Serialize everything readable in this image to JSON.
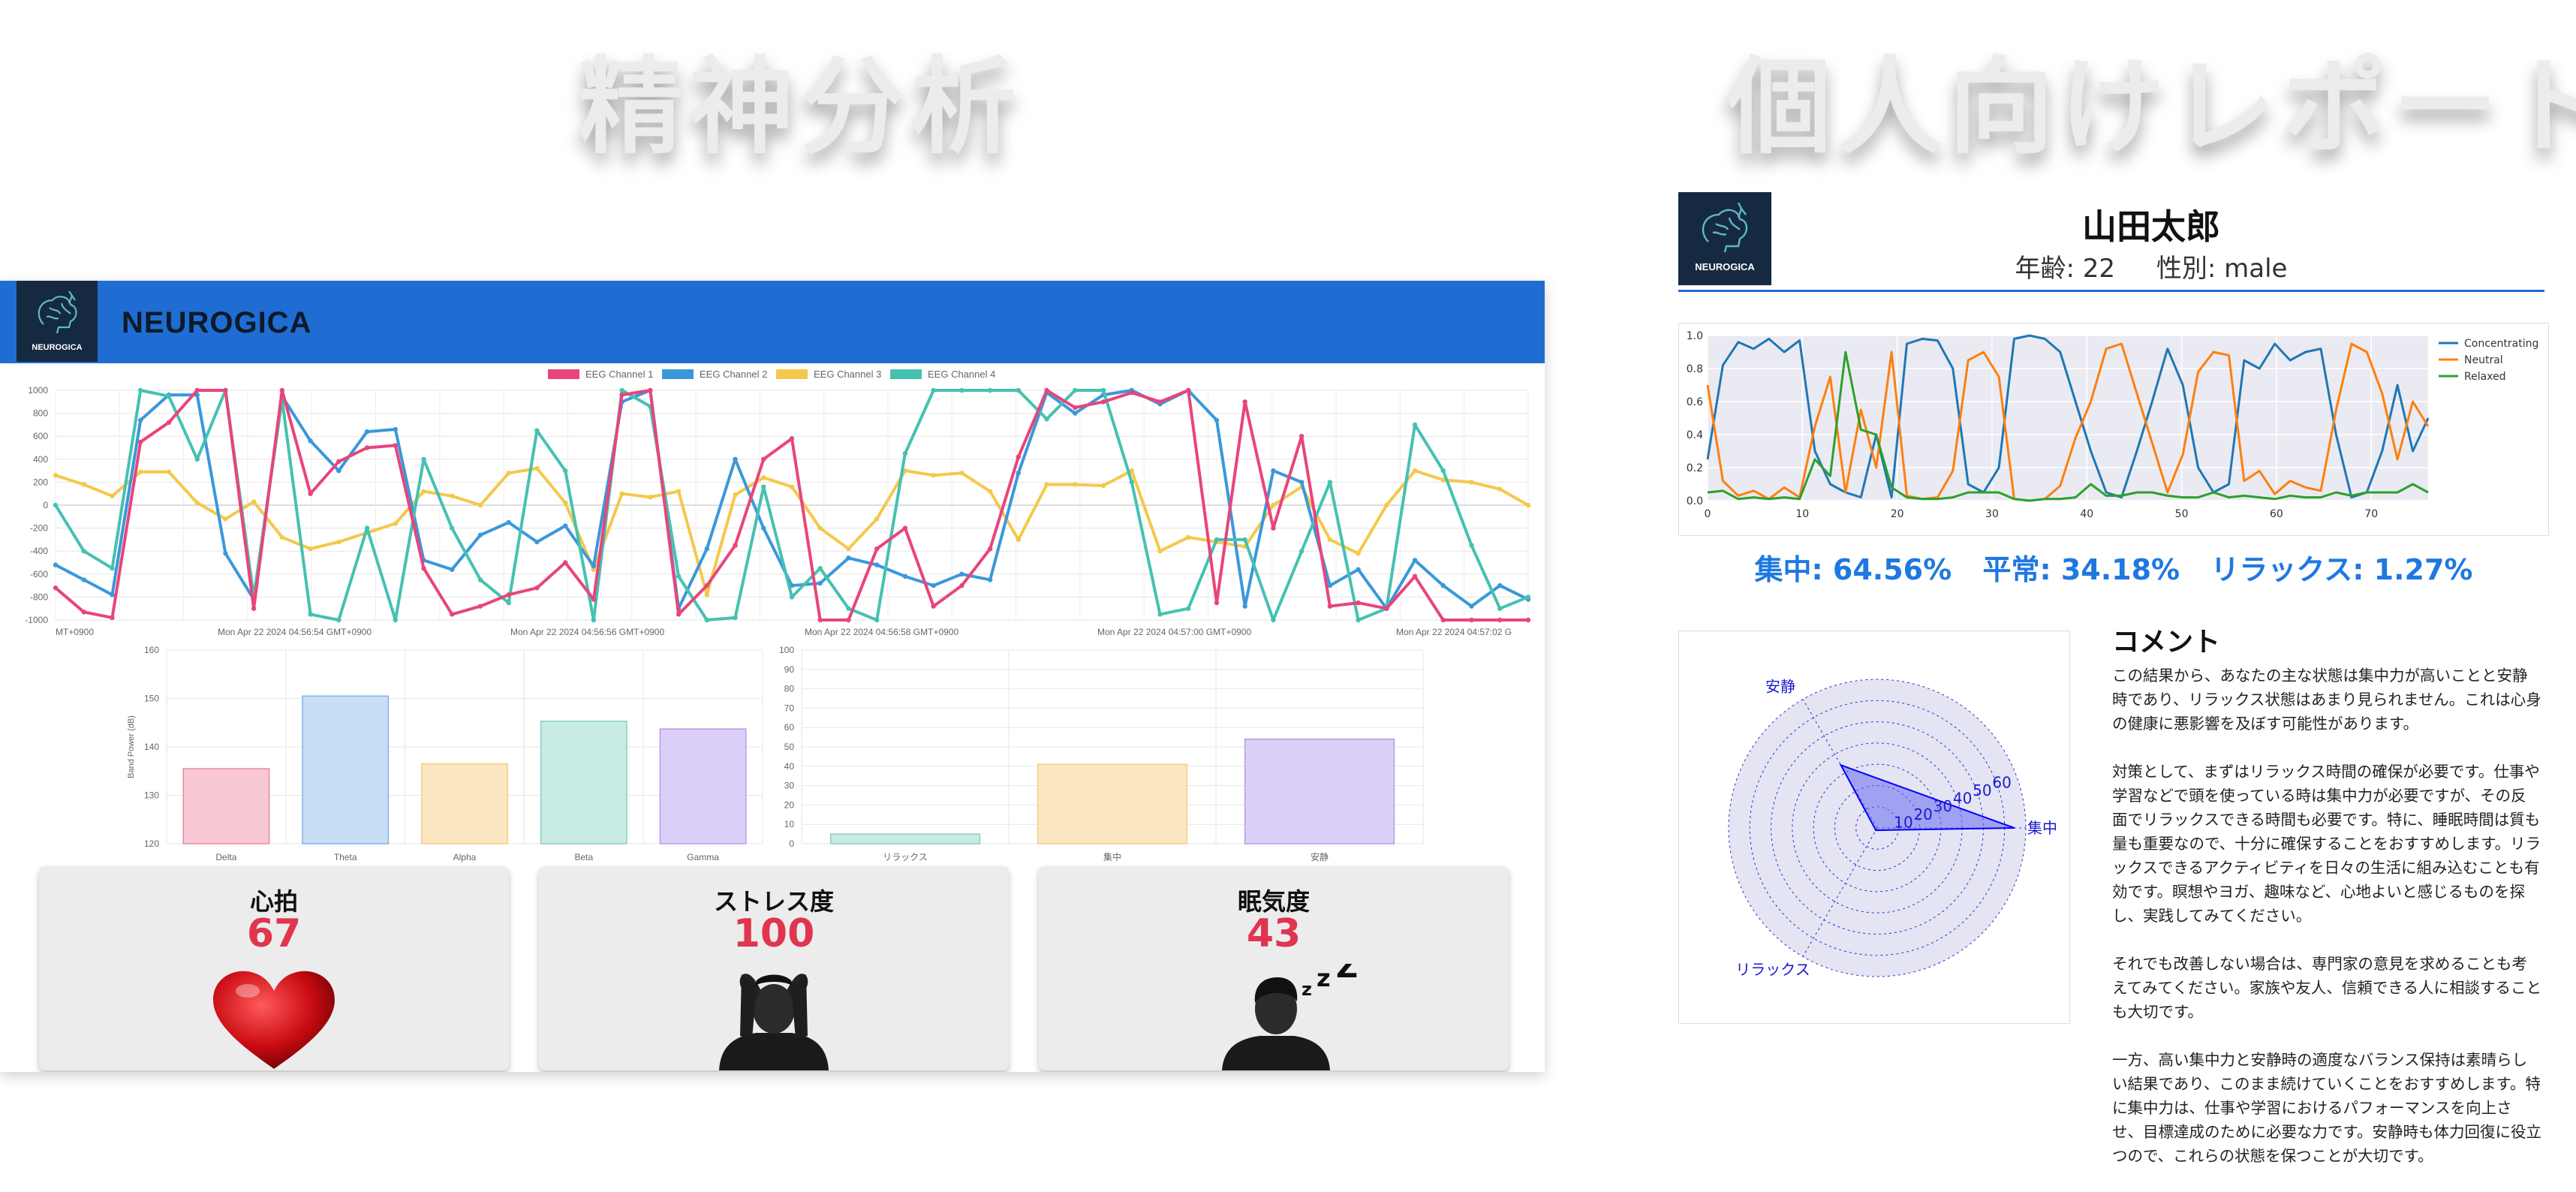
{
  "headlines": {
    "left": "精神分析",
    "right": "個人向けレポート"
  },
  "dashboard": {
    "brand": "NEUROGICA",
    "logo_text": "NEUROGICA",
    "metrics": [
      {
        "label": "心拍",
        "value": "67",
        "icon": "heart-icon"
      },
      {
        "label": "ストレス度",
        "value": "100",
        "icon": "stressed-person-icon"
      },
      {
        "label": "眠気度",
        "value": "43",
        "icon": "sleepy-person-icon"
      }
    ]
  },
  "colors": {
    "brand_blue": "#1f6dd2",
    "metric_red": "#e0344f",
    "summary_blue": "#1f78e0"
  },
  "chart_data": [
    {
      "type": "line",
      "legend": [
        "EEG Channel 1",
        "EEG Channel 2",
        "EEG Channel 3",
        "EEG Channel 4"
      ],
      "legend_position": "top",
      "colors": [
        "#e8457a",
        "#3a98da",
        "#f4c84b",
        "#45c1b2"
      ],
      "ylim": [
        -1000,
        1000
      ],
      "yticks": [
        "1000",
        "800",
        "600",
        "400",
        "200",
        "0",
        "-200",
        "-400",
        "-600",
        "-800",
        "-1000"
      ],
      "xtick_labels": [
        "MT+0900",
        "Mon Apr 22 2024 04:56:54 GMT+0900",
        "Mon Apr 22 2024 04:56:56 GMT+0900",
        "Mon Apr 22 2024 04:56:58 GMT+0900",
        "Mon Apr 22 2024 04:57:00 GMT+0900",
        "Mon Apr 22 2024 04:57:02 G"
      ],
      "series": [
        {
          "name": "EEG Channel 1",
          "values": [
            -720,
            -930,
            -980,
            550,
            720,
            1000,
            1000,
            -900,
            1000,
            100,
            380,
            500,
            520,
            -550,
            -950,
            -880,
            -780,
            -720,
            -500,
            -820,
            960,
            1000,
            -950,
            -700,
            -350,
            400,
            580,
            -1000,
            -1000,
            -380,
            -200,
            -880,
            -700,
            -380,
            420,
            1000,
            850,
            900,
            980,
            900,
            1000,
            -850,
            900,
            -200,
            600,
            -880,
            -850,
            -900,
            -620,
            -1000,
            -1000,
            -1000,
            -1000
          ]
        },
        {
          "name": "EEG Channel 2",
          "values": [
            -520,
            -650,
            -780,
            740,
            960,
            960,
            -420,
            -820,
            950,
            560,
            300,
            640,
            660,
            -480,
            -560,
            -260,
            -150,
            -320,
            -180,
            -530,
            900,
            1000,
            -900,
            -380,
            400,
            -200,
            -700,
            -680,
            -460,
            -520,
            -620,
            -700,
            -600,
            -650,
            280,
            980,
            800,
            960,
            1000,
            880,
            1000,
            740,
            -880,
            300,
            200,
            -700,
            -560,
            -900,
            -480,
            -700,
            -880,
            -700,
            -820
          ]
        },
        {
          "name": "EEG Channel 3",
          "values": [
            260,
            180,
            80,
            290,
            290,
            20,
            -120,
            30,
            -280,
            -380,
            -320,
            -240,
            -160,
            120,
            80,
            0,
            280,
            320,
            20,
            -560,
            100,
            70,
            120,
            -780,
            90,
            240,
            160,
            -200,
            -380,
            -120,
            300,
            260,
            280,
            120,
            -300,
            180,
            180,
            170,
            300,
            -400,
            -280,
            -320,
            -360,
            0,
            160,
            -300,
            -420,
            0,
            300,
            220,
            200,
            140,
            0
          ]
        },
        {
          "name": "EEG Channel 4",
          "values": [
            0,
            -400,
            -550,
            1000,
            950,
            400,
            1000,
            -800,
            920,
            -950,
            -1000,
            -200,
            -1000,
            400,
            -200,
            -650,
            -850,
            650,
            300,
            -1000,
            1000,
            860,
            -620,
            -1000,
            -980,
            160,
            -800,
            -550,
            -900,
            -1000,
            450,
            1000,
            1000,
            1000,
            1000,
            750,
            1000,
            1000,
            200,
            -950,
            -900,
            -300,
            -300,
            -1000,
            -400,
            200,
            -1000,
            -900,
            700,
            300,
            -350,
            -900,
            -800
          ]
        }
      ]
    },
    {
      "type": "bar",
      "categories": [
        "Delta",
        "Theta",
        "Alpha",
        "Beta",
        "Gamma"
      ],
      "values": [
        135.5,
        150.5,
        136.5,
        145.3,
        143.7
      ],
      "colors": [
        "#f8c8d4",
        "#c8def5",
        "#fbe8c2",
        "#c8ebe6",
        "#ddd0f8"
      ],
      "borders": [
        "#e58aa4",
        "#7fb3e6",
        "#f3ce84",
        "#86d1c4",
        "#b69ae8"
      ],
      "ylabel": "Band Power (dB)",
      "ylim": [
        120,
        160
      ],
      "yticks": [
        "160",
        "150",
        "140",
        "130",
        "120"
      ]
    },
    {
      "type": "bar",
      "categories": [
        "リラックス",
        "集中",
        "安静"
      ],
      "values": [
        5,
        41,
        54
      ],
      "colors": [
        "#c8ebe6",
        "#fbe8c2",
        "#ddd0f8"
      ],
      "borders": [
        "#86d1c4",
        "#f3ce84",
        "#b69ae8"
      ],
      "ylim": [
        0,
        100
      ],
      "yticks": [
        "100",
        "90",
        "80",
        "70",
        "60",
        "50",
        "40",
        "30",
        "20",
        "10",
        "0"
      ]
    },
    {
      "type": "line",
      "legend": [
        "Concentrating",
        "Neutral",
        "Relaxed"
      ],
      "legend_position": "top-right",
      "colors": [
        "#1f77b4",
        "#ff7f0e",
        "#2ca02c"
      ],
      "ylim": [
        0,
        1
      ],
      "xlim": [
        0,
        76
      ],
      "yticks": [
        "1.0",
        "0.8",
        "0.6",
        "0.4",
        "0.2",
        "0.0"
      ],
      "xticks": [
        "0",
        "10",
        "20",
        "30",
        "40",
        "50",
        "60",
        "70"
      ],
      "grid": true,
      "series": [
        {
          "name": "Concentrating",
          "values": [
            0.25,
            0.82,
            0.96,
            0.92,
            0.98,
            0.9,
            0.97,
            0.3,
            0.1,
            0.05,
            0.02,
            0.4,
            0.02,
            0.95,
            0.98,
            0.97,
            0.8,
            0.1,
            0.05,
            0.2,
            0.98,
            1.0,
            0.98,
            0.9,
            0.6,
            0.3,
            0.05,
            0.02,
            0.3,
            0.6,
            0.92,
            0.7,
            0.2,
            0.05,
            0.1,
            0.85,
            0.8,
            0.95,
            0.85,
            0.9,
            0.92,
            0.4,
            0.02,
            0.05,
            0.3,
            0.7,
            0.3,
            0.5
          ]
        },
        {
          "name": "Neutral",
          "values": [
            0.7,
            0.12,
            0.03,
            0.06,
            0.01,
            0.08,
            0.02,
            0.45,
            0.75,
            0.05,
            0.55,
            0.2,
            0.9,
            0.03,
            0.01,
            0.02,
            0.18,
            0.85,
            0.9,
            0.75,
            0.01,
            0.0,
            0.01,
            0.09,
            0.38,
            0.6,
            0.92,
            0.95,
            0.65,
            0.35,
            0.05,
            0.28,
            0.78,
            0.9,
            0.88,
            0.12,
            0.18,
            0.04,
            0.12,
            0.08,
            0.06,
            0.55,
            0.95,
            0.9,
            0.65,
            0.25,
            0.6,
            0.45
          ]
        },
        {
          "name": "Relaxed",
          "values": [
            0.05,
            0.06,
            0.01,
            0.02,
            0.01,
            0.02,
            0.01,
            0.25,
            0.15,
            0.9,
            0.43,
            0.4,
            0.08,
            0.02,
            0.01,
            0.01,
            0.02,
            0.05,
            0.05,
            0.05,
            0.01,
            0.0,
            0.01,
            0.01,
            0.02,
            0.1,
            0.03,
            0.03,
            0.05,
            0.05,
            0.03,
            0.02,
            0.02,
            0.05,
            0.02,
            0.03,
            0.02,
            0.01,
            0.03,
            0.02,
            0.02,
            0.05,
            0.03,
            0.05,
            0.05,
            0.05,
            0.1,
            0.05
          ]
        }
      ]
    },
    {
      "type": "radar",
      "categories": [
        "集中",
        "安静",
        "リラックス"
      ],
      "values": [
        64.56,
        34.18,
        1.27
      ],
      "rticks": [
        "10",
        "20",
        "30",
        "40",
        "50",
        "60"
      ],
      "rmax": 70,
      "colors": [
        "#0000ff"
      ]
    }
  ],
  "report": {
    "name": "山田太郎",
    "age": "年齢: 22",
    "gender": "性別: male",
    "logo_text": "NEUROGICA",
    "summary": [
      "集中: 64.56%",
      "平常: 34.18%",
      "リラックス: 1.27%"
    ],
    "comment_title": "コメント",
    "comments": [
      "この結果から、あなたの主な状態は集中力が高いことと安静時であり、リラックス状態はあまり見られません。これは心身の健康に悪影響を及ぼす可能性があります。",
      "対策として、まずはリラックス時間の確保が必要です。仕事や学習などで頭を使っている時は集中力が必要ですが、その反面でリラックスできる時間も必要です。特に、睡眠時間は質も量も重要なので、十分に確保することをおすすめします。リラックスできるアクティビティを日々の生活に組み込むことも有効です。瞑想やヨガ、趣味など、心地よいと感じるものを探し、実践してみてください。",
      "それでも改善しない場合は、専門家の意見を求めることも考えてみてください。家族や友人、信頼できる人に相談することも大切です。",
      "一方、高い集中力と安静時の適度なバランス保持は素晴らしい結果であり、このまま続けていくことをおすすめします。特に集中力は、仕事や学習におけるパフォーマンスを向上させ、目標達成のために必要な力です。安静時も体力回復に役立つので、これらの状態を保つことが大切です。"
    ]
  }
}
